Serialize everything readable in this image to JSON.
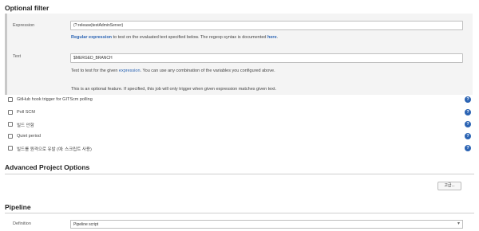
{
  "optional_filter": {
    "title": "Optional filter",
    "expression": {
      "label": "Expression",
      "value": "(?:release|testAdminServer)",
      "help_link": "Regular expression",
      "help_text": " to test on the evaluated text specified below. The regexp syntax is documented ",
      "help_here": "here",
      "help_end": "."
    },
    "text": {
      "label": "Text",
      "value": "$MERGED_BRANCH",
      "help_start": "Text to test for the given ",
      "help_link": "expression",
      "help_end": ". You can use any combination of the variables you configured above."
    },
    "note": "This is an optional feature. If specified, this job will only trigger when given expression matches given text."
  },
  "triggers": [
    {
      "label": "GitHub hook trigger for GITScm polling"
    },
    {
      "label": "Poll SCM"
    },
    {
      "label": "빌드 안함"
    },
    {
      "label": "Quiet period"
    },
    {
      "label": "빌드를 원격으로 유발 (예: 스크립트 사용)"
    }
  ],
  "advanced": {
    "title": "Advanced Project Options",
    "button_label": "고급..."
  },
  "pipeline": {
    "title": "Pipeline",
    "definition_label": "Definition",
    "definition_value": "Pipeline script"
  },
  "help_icon_glyph": "?",
  "colors": {
    "link": "#2a63b3"
  }
}
